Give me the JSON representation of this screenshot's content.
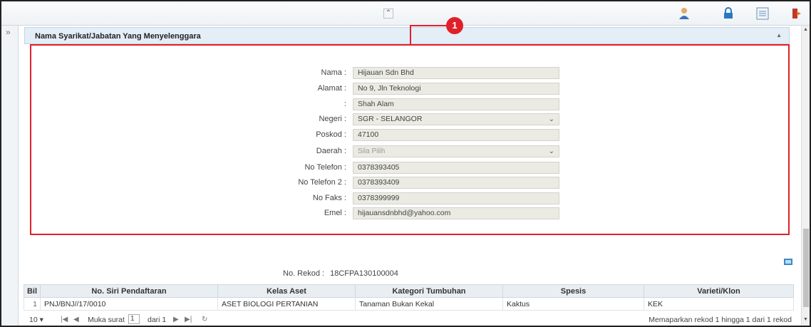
{
  "callout": {
    "number": "1"
  },
  "panel": {
    "title": "Nama Syarikat/Jabatan Yang Menyelenggara"
  },
  "form": {
    "nama": {
      "label": "Nama :",
      "value": "Hijauan Sdn Bhd"
    },
    "alamat": {
      "label": "Alamat :",
      "value": "No 9, Jln Teknologi"
    },
    "alamat2": {
      "label": ":",
      "value": "Shah Alam"
    },
    "negeri": {
      "label": "Negeri :",
      "value": "SGR - SELANGOR"
    },
    "poskod": {
      "label": "Poskod :",
      "value": "47100"
    },
    "daerah": {
      "label": "Daerah :",
      "placeholder": "Sila Pilih"
    },
    "telefon": {
      "label": "No Telefon :",
      "value": "0378393405"
    },
    "telefon2": {
      "label": "No Telefon 2 :",
      "value": "0378393409"
    },
    "faks": {
      "label": "No Faks :",
      "value": "0378399999"
    },
    "emel": {
      "label": "Emel :",
      "value": "hijauansdnbhd@yahoo.com"
    }
  },
  "rekod": {
    "label": "No. Rekod :",
    "value": "18CFPA130100004"
  },
  "table": {
    "headers": [
      "Bil",
      "No. Siri Pendaftaran",
      "Kelas Aset",
      "Kategori Tumbuhan",
      "Spesis",
      "Varieti/Klon"
    ],
    "rows": [
      [
        "1",
        "PNJ/BNJ//17/0010",
        "ASET BIOLOGI PERTANIAN",
        "Tanaman Bukan Kekal",
        "Kaktus",
        "KEK"
      ]
    ]
  },
  "pager": {
    "page_size": "10 ▾",
    "page_label": "Muka surat",
    "page_value": "1",
    "of_label": "dari 1",
    "info": "Memaparkan rekod 1 hingga 1 dari 1 rekod"
  },
  "icons": {
    "collapse": "double-chevron-up-icon",
    "expand": "double-chevron-right-icon",
    "user": "user-icon",
    "lock": "lock-icon",
    "list": "list-icon",
    "exit": "exit-icon"
  },
  "colors": {
    "accent_red": "#e0202a",
    "header_bg": "#e4eef7",
    "field_bg": "#ebebe4"
  }
}
